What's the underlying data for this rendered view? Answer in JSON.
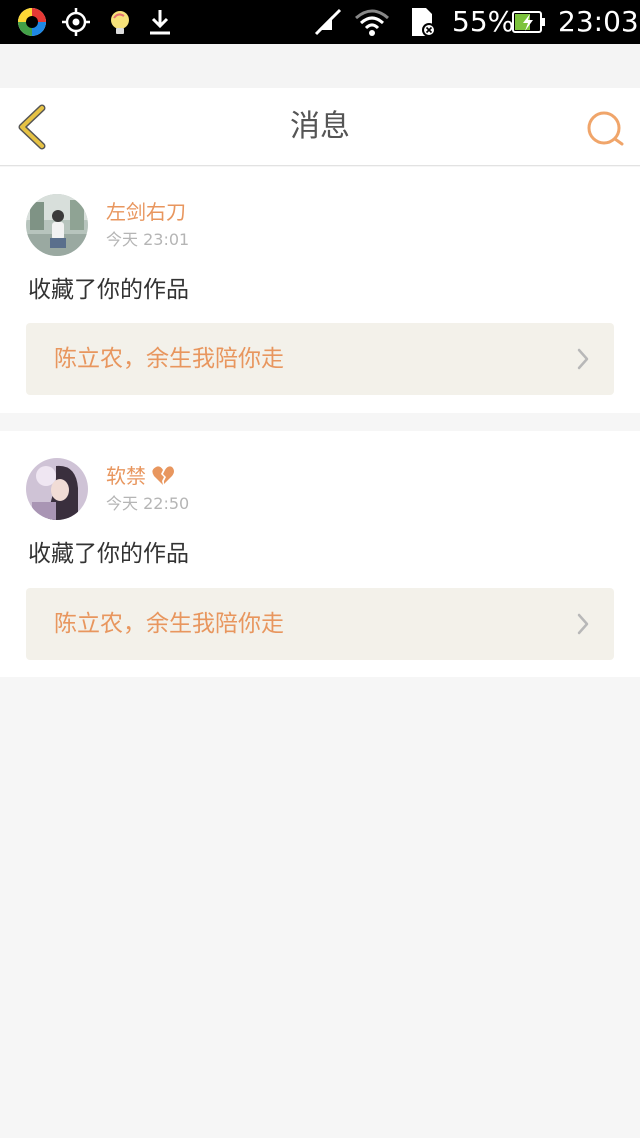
{
  "status_bar": {
    "battery": "55%",
    "time": "23:03",
    "icons": [
      "360-security-icon",
      "crosshair-icon",
      "lightbulb-icon",
      "download-icon",
      "mute-icon",
      "wifi-icon",
      "sdcard-error-icon",
      "battery-charging-icon"
    ]
  },
  "header": {
    "title": "消息",
    "back_icon": "chevron-left-icon",
    "search_icon": "search-icon"
  },
  "messages": [
    {
      "username": "左剑右刀",
      "time": "今天 23:01",
      "action": "收藏了你的作品",
      "work_title": "陈立农，余生我陪你走"
    },
    {
      "username": "软禁",
      "time": "今天 22:50",
      "action": "收藏了你的作品",
      "work_title": "陈立农，余生我陪你走",
      "username_emoji": "broken-heart-icon"
    }
  ],
  "colors": {
    "accent": "#e8965e",
    "back_icon": "#e6c244",
    "card_link_bg": "#f3f1ea"
  }
}
